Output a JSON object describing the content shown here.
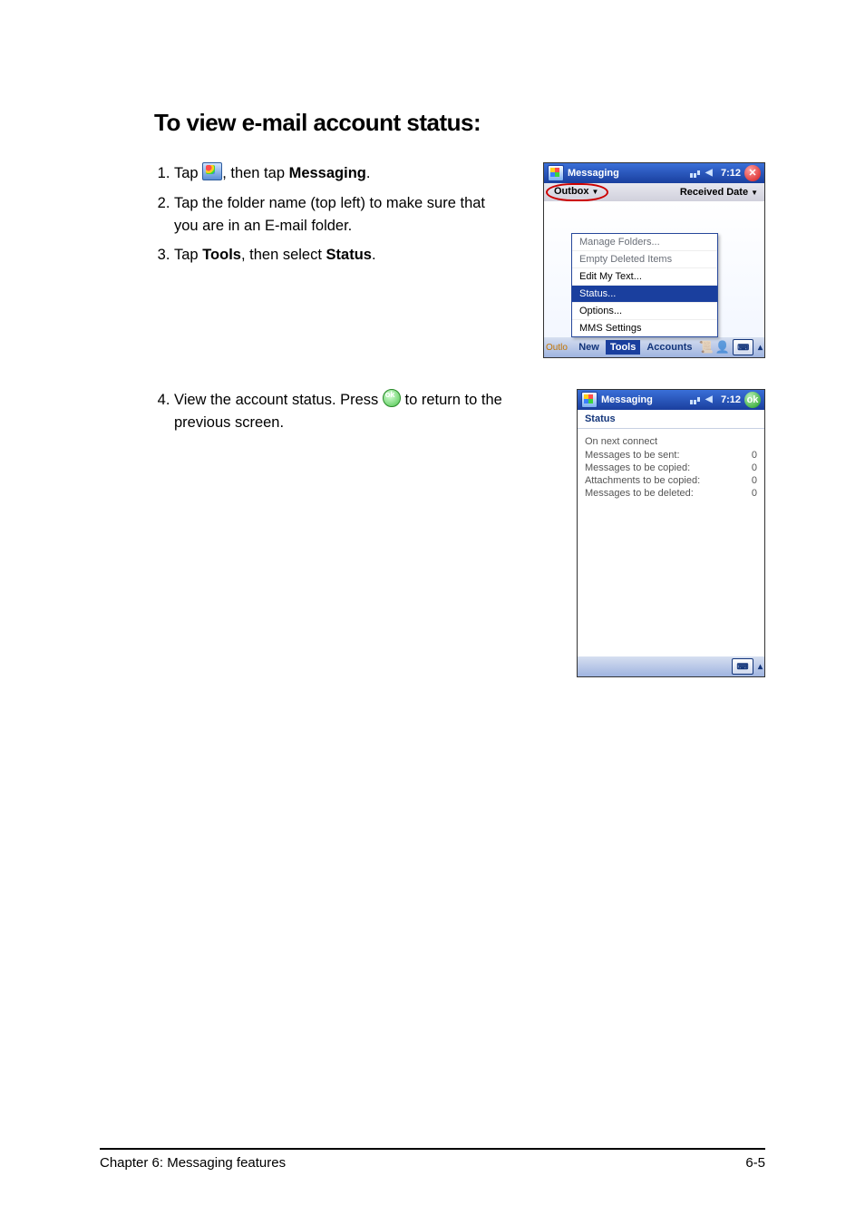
{
  "title": "To view e-mail account status:",
  "steps": {
    "s1_a": "Tap ",
    "s1_b": ", then tap ",
    "s1_c": "Messaging",
    "s1_d": ".",
    "s2": "Tap the folder name (top left) to make sure that you are in an E-mail folder.",
    "s3_a": "Tap ",
    "s3_b": "Tools",
    "s3_c": ", then select ",
    "s3_d": "Status",
    "s3_e": ".",
    "s4_a": "View the account status. Press ",
    "s4_b": " to return to the previous screen."
  },
  "device1": {
    "title": "Messaging",
    "time": "7:12",
    "folder": "Outbox",
    "sortlabel": "Received Date",
    "menu": {
      "manage": "Manage Folders...",
      "empty": "Empty Deleted Items",
      "edit": "Edit My Text...",
      "status": "Status...",
      "options": "Options...",
      "mms": "MMS Settings"
    },
    "menubar": {
      "outlo": "Outlo",
      "new": "New",
      "tools": "Tools",
      "accounts": "Accounts"
    }
  },
  "device2": {
    "title": "Messaging",
    "time": "7:12",
    "status_label": "Status",
    "heading": "On next connect",
    "rows": [
      {
        "label": "Messages to be sent:",
        "value": "0"
      },
      {
        "label": "Messages to be copied:",
        "value": "0"
      },
      {
        "label": "Attachments to be copied:",
        "value": "0"
      },
      {
        "label": "Messages to be deleted:",
        "value": "0"
      }
    ]
  },
  "footer": {
    "left": "Chapter 6: Messaging features",
    "right": "6-5"
  }
}
